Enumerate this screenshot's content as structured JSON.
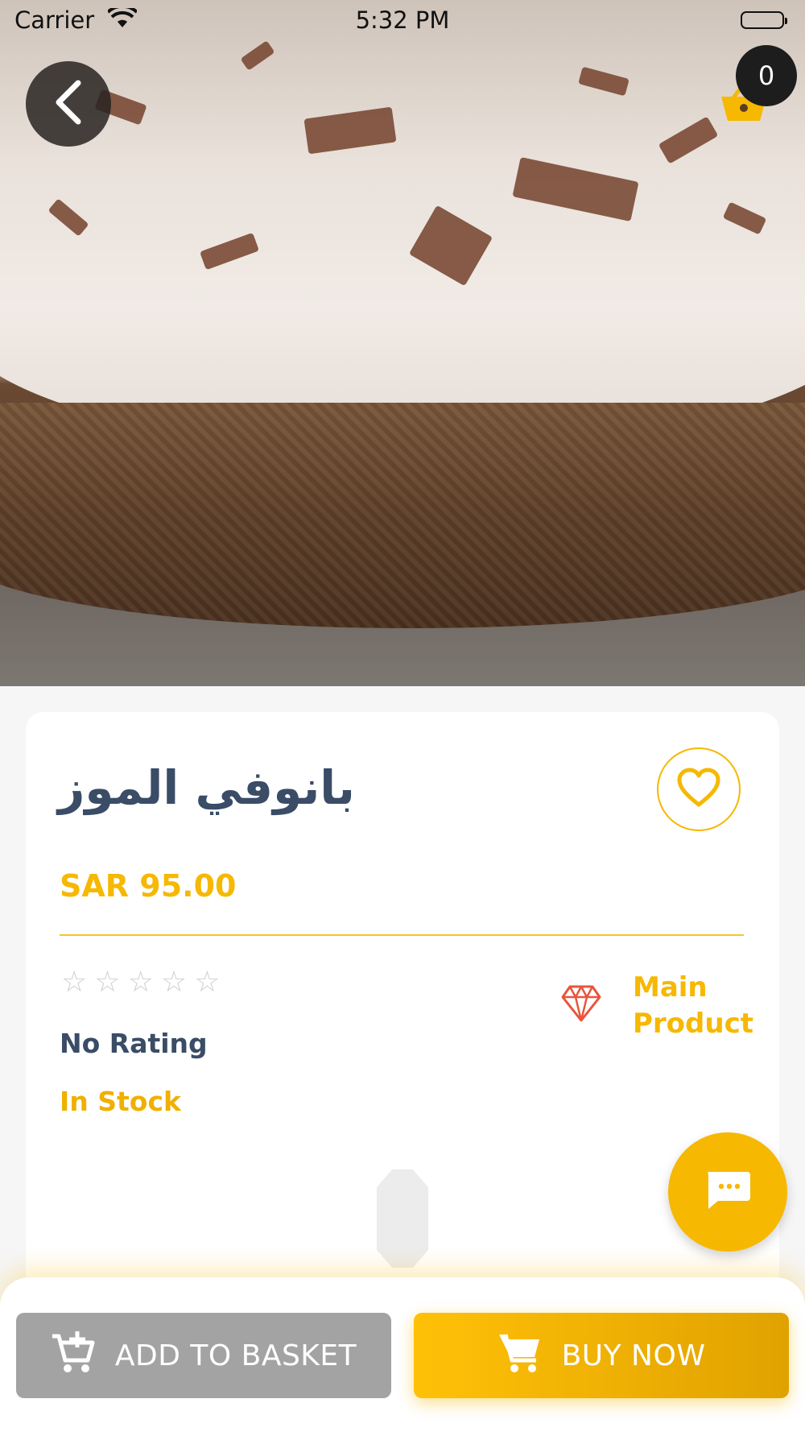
{
  "status_bar": {
    "carrier": "Carrier",
    "time": "5:32 PM"
  },
  "header": {
    "cart_count": "0"
  },
  "product": {
    "name": "بانوفي الموز",
    "price": "SAR 95.00",
    "rating_stars": 0,
    "rating_max": 5,
    "rating_text": "No Rating",
    "stock_status": "In Stock",
    "type_line1": "Main",
    "type_line2": "Product"
  },
  "actions": {
    "add_to_basket": "ADD TO BASKET",
    "buy_now": "BUY NOW"
  },
  "icons": {
    "back": "chevron-left-icon",
    "basket": "basket-icon",
    "favorite": "heart-icon",
    "product_type": "diamond-icon",
    "chat": "chat-bubble-icon",
    "add_to_basket": "cart-plus-icon",
    "buy_now": "cart-icon"
  },
  "colors": {
    "accent": "#f6b800",
    "title": "#3a4c66",
    "gem": "#e8553a",
    "basket_button": "#a3a3a3"
  }
}
